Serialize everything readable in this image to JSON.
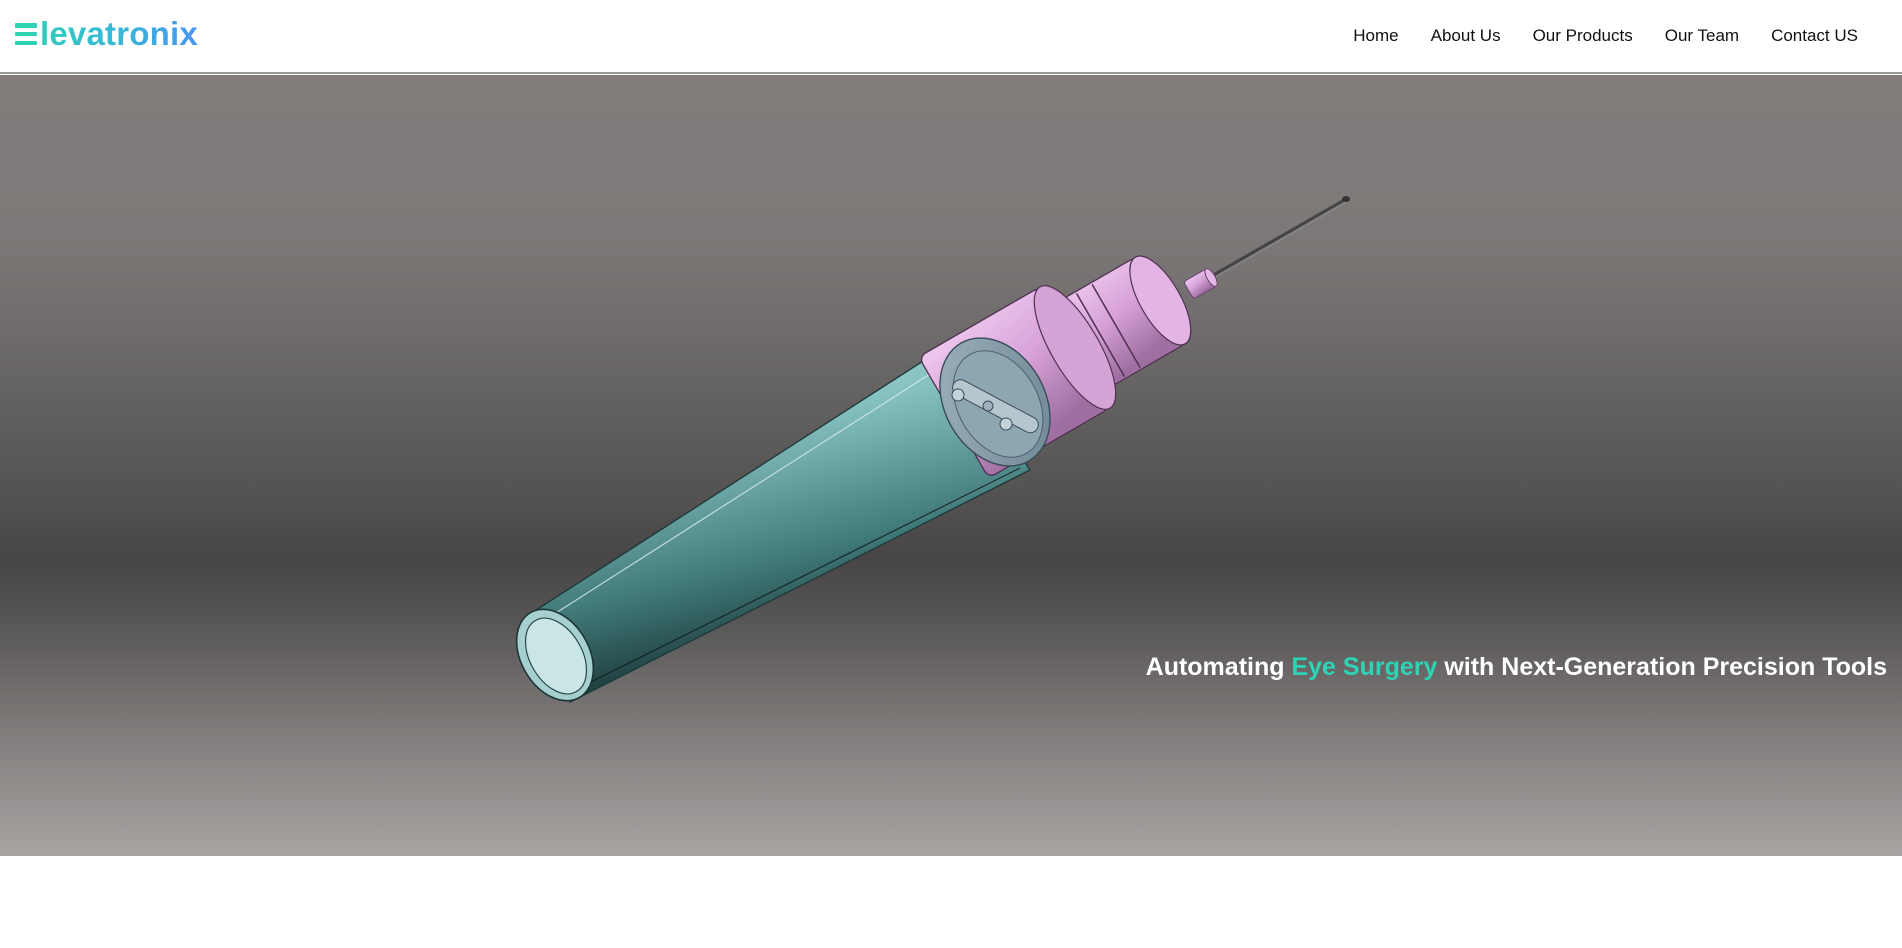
{
  "brand": {
    "name": "levatronix",
    "icon": "hamburger-e-icon",
    "gradient": [
      "#2ed3b6",
      "#4a94f2"
    ]
  },
  "nav": {
    "items": [
      {
        "label": "Home"
      },
      {
        "label": "About Us"
      },
      {
        "label": "Our Products"
      },
      {
        "label": "Our Team"
      },
      {
        "label": "Contact US"
      }
    ]
  },
  "hero": {
    "headline_before": "Automating ",
    "headline_accent": "Eye Surgery",
    "headline_after": " with Next-Generation Precision Tools",
    "accent_color": "#2ed3b6",
    "image": "surgical-handpiece-render"
  }
}
